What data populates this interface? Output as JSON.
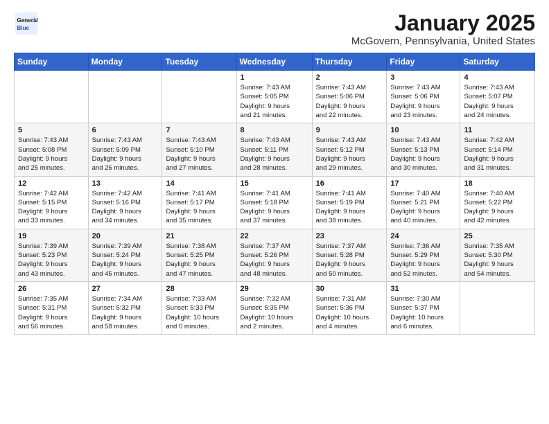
{
  "header": {
    "logo_general": "General",
    "logo_blue": "Blue",
    "title": "January 2025",
    "subtitle": "McGovern, Pennsylvania, United States"
  },
  "calendar": {
    "days_of_week": [
      "Sunday",
      "Monday",
      "Tuesday",
      "Wednesday",
      "Thursday",
      "Friday",
      "Saturday"
    ],
    "weeks": [
      [
        {
          "day": "",
          "info": ""
        },
        {
          "day": "",
          "info": ""
        },
        {
          "day": "",
          "info": ""
        },
        {
          "day": "1",
          "info": "Sunrise: 7:43 AM\nSunset: 5:05 PM\nDaylight: 9 hours\nand 21 minutes."
        },
        {
          "day": "2",
          "info": "Sunrise: 7:43 AM\nSunset: 5:06 PM\nDaylight: 9 hours\nand 22 minutes."
        },
        {
          "day": "3",
          "info": "Sunrise: 7:43 AM\nSunset: 5:06 PM\nDaylight: 9 hours\nand 23 minutes."
        },
        {
          "day": "4",
          "info": "Sunrise: 7:43 AM\nSunset: 5:07 PM\nDaylight: 9 hours\nand 24 minutes."
        }
      ],
      [
        {
          "day": "5",
          "info": "Sunrise: 7:43 AM\nSunset: 5:08 PM\nDaylight: 9 hours\nand 25 minutes."
        },
        {
          "day": "6",
          "info": "Sunrise: 7:43 AM\nSunset: 5:09 PM\nDaylight: 9 hours\nand 26 minutes."
        },
        {
          "day": "7",
          "info": "Sunrise: 7:43 AM\nSunset: 5:10 PM\nDaylight: 9 hours\nand 27 minutes."
        },
        {
          "day": "8",
          "info": "Sunrise: 7:43 AM\nSunset: 5:11 PM\nDaylight: 9 hours\nand 28 minutes."
        },
        {
          "day": "9",
          "info": "Sunrise: 7:43 AM\nSunset: 5:12 PM\nDaylight: 9 hours\nand 29 minutes."
        },
        {
          "day": "10",
          "info": "Sunrise: 7:43 AM\nSunset: 5:13 PM\nDaylight: 9 hours\nand 30 minutes."
        },
        {
          "day": "11",
          "info": "Sunrise: 7:42 AM\nSunset: 5:14 PM\nDaylight: 9 hours\nand 31 minutes."
        }
      ],
      [
        {
          "day": "12",
          "info": "Sunrise: 7:42 AM\nSunset: 5:15 PM\nDaylight: 9 hours\nand 33 minutes."
        },
        {
          "day": "13",
          "info": "Sunrise: 7:42 AM\nSunset: 5:16 PM\nDaylight: 9 hours\nand 34 minutes."
        },
        {
          "day": "14",
          "info": "Sunrise: 7:41 AM\nSunset: 5:17 PM\nDaylight: 9 hours\nand 35 minutes."
        },
        {
          "day": "15",
          "info": "Sunrise: 7:41 AM\nSunset: 5:18 PM\nDaylight: 9 hours\nand 37 minutes."
        },
        {
          "day": "16",
          "info": "Sunrise: 7:41 AM\nSunset: 5:19 PM\nDaylight: 9 hours\nand 38 minutes."
        },
        {
          "day": "17",
          "info": "Sunrise: 7:40 AM\nSunset: 5:21 PM\nDaylight: 9 hours\nand 40 minutes."
        },
        {
          "day": "18",
          "info": "Sunrise: 7:40 AM\nSunset: 5:22 PM\nDaylight: 9 hours\nand 42 minutes."
        }
      ],
      [
        {
          "day": "19",
          "info": "Sunrise: 7:39 AM\nSunset: 5:23 PM\nDaylight: 9 hours\nand 43 minutes."
        },
        {
          "day": "20",
          "info": "Sunrise: 7:39 AM\nSunset: 5:24 PM\nDaylight: 9 hours\nand 45 minutes."
        },
        {
          "day": "21",
          "info": "Sunrise: 7:38 AM\nSunset: 5:25 PM\nDaylight: 9 hours\nand 47 minutes."
        },
        {
          "day": "22",
          "info": "Sunrise: 7:37 AM\nSunset: 5:26 PM\nDaylight: 9 hours\nand 48 minutes."
        },
        {
          "day": "23",
          "info": "Sunrise: 7:37 AM\nSunset: 5:28 PM\nDaylight: 9 hours\nand 50 minutes."
        },
        {
          "day": "24",
          "info": "Sunrise: 7:36 AM\nSunset: 5:29 PM\nDaylight: 9 hours\nand 52 minutes."
        },
        {
          "day": "25",
          "info": "Sunrise: 7:35 AM\nSunset: 5:30 PM\nDaylight: 9 hours\nand 54 minutes."
        }
      ],
      [
        {
          "day": "26",
          "info": "Sunrise: 7:35 AM\nSunset: 5:31 PM\nDaylight: 9 hours\nand 56 minutes."
        },
        {
          "day": "27",
          "info": "Sunrise: 7:34 AM\nSunset: 5:32 PM\nDaylight: 9 hours\nand 58 minutes."
        },
        {
          "day": "28",
          "info": "Sunrise: 7:33 AM\nSunset: 5:33 PM\nDaylight: 10 hours\nand 0 minutes."
        },
        {
          "day": "29",
          "info": "Sunrise: 7:32 AM\nSunset: 5:35 PM\nDaylight: 10 hours\nand 2 minutes."
        },
        {
          "day": "30",
          "info": "Sunrise: 7:31 AM\nSunset: 5:36 PM\nDaylight: 10 hours\nand 4 minutes."
        },
        {
          "day": "31",
          "info": "Sunrise: 7:30 AM\nSunset: 5:37 PM\nDaylight: 10 hours\nand 6 minutes."
        },
        {
          "day": "",
          "info": ""
        }
      ]
    ]
  }
}
